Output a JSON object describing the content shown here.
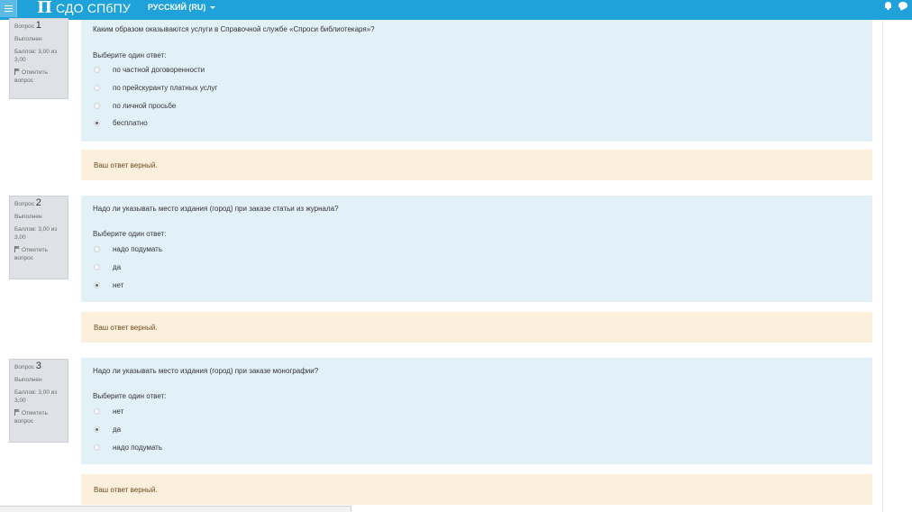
{
  "nav": {
    "brand_logo": "Π",
    "brand_text": "СДО СПбПУ",
    "language": "Русский (ru)",
    "icons": [
      "hamburger-icon",
      "bell-icon",
      "chat-icon"
    ]
  },
  "questions": [
    {
      "label": "Вопрос",
      "number": "1",
      "state": "Выполнен",
      "grade": "Баллов: 3,00 из 3,00",
      "flag_label": "Отметить вопрос",
      "text": "Каким образом оказываются услуги в Справочной службе «Спроси библиотекаря»?",
      "prompt": "Выберите один ответ:",
      "options": [
        "по частной договоренности",
        "по прейскуранту платных услуг",
        "по личной просьбе",
        "бесплатно"
      ],
      "selected_index": 3,
      "feedback": "Ваш ответ верный."
    },
    {
      "label": "Вопрос",
      "number": "2",
      "state": "Выполнен",
      "grade": "Баллов: 3,00 из 3,00",
      "flag_label": "Отметить вопрос",
      "text": "Надо ли указывать место издания (город) при заказе статьи из журнала?",
      "prompt": "Выберите один ответ:",
      "options": [
        "надо подумать",
        "да",
        "нет"
      ],
      "selected_index": 2,
      "feedback": "Ваш ответ верный."
    },
    {
      "label": "Вопрос",
      "number": "3",
      "state": "Выполнен",
      "grade": "Баллов: 3,00 из 3,00",
      "flag_label": "Отметить вопрос",
      "text": "Надо ли указывать место издания (город) при заказе монографии?",
      "prompt": "Выберите один ответ:",
      "options": [
        "нет",
        "да",
        "надо подумать"
      ],
      "selected_index": 1,
      "feedback": "Ваш ответ верный."
    }
  ],
  "colors": {
    "navbar": "#1ea2d9",
    "question_bg": "#e2f1f8",
    "feedback_bg": "#fcefdc",
    "info_bg": "#dee2e6"
  }
}
